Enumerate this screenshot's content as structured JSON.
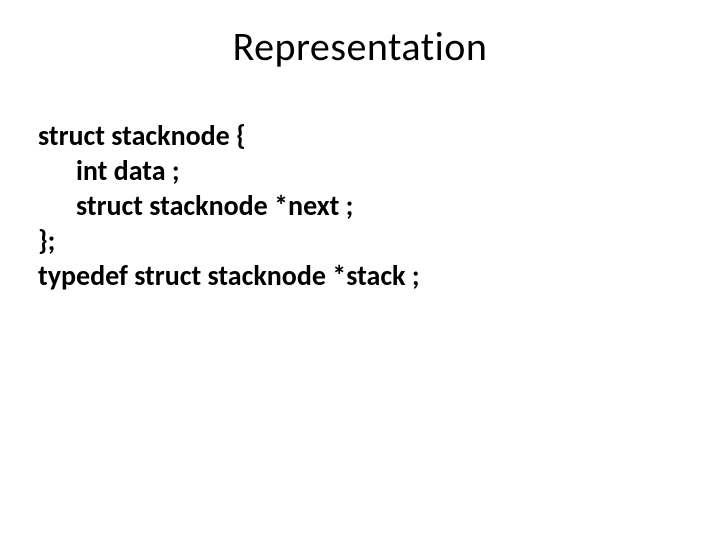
{
  "title": "Representation",
  "code": {
    "line1": "struct stacknode {",
    "line2": "int data ;",
    "line3": "struct stacknode *next ;",
    "line4": "};",
    "line5": "typedef struct stacknode  *stack ;"
  }
}
